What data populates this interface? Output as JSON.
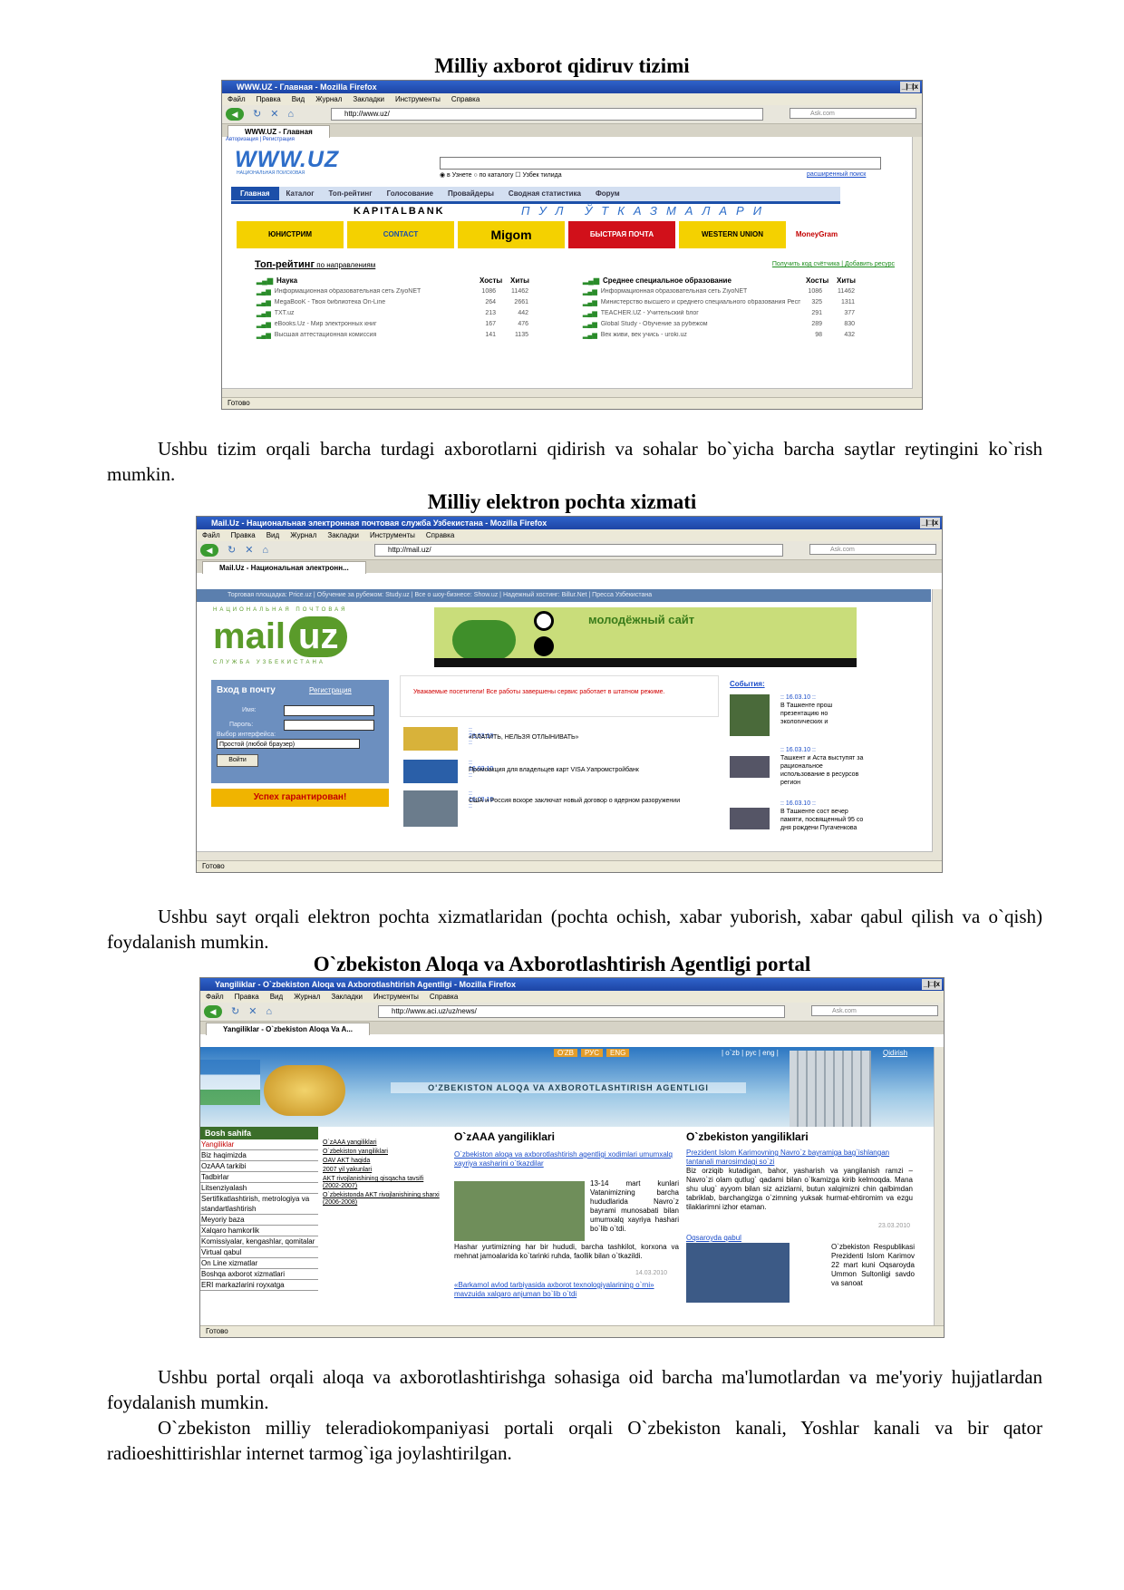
{
  "heading1": "Milliy axborot qidiruv tizimi",
  "heading2": "Milliy elektron pochta xizmati",
  "heading3": "O`zbekiston Aloqa va Axborotlashtirish Agentligi portal",
  "para1": "Ushbu tizim orqali barcha turdagi axborotlarni qidirish va sohalar bo`yicha barcha saytlar reytingini ko`rish mumkin.",
  "para2": "Ushbu sayt orqali elektron pochta xizmatlaridan (pochta ochish, xabar yuborish, xabar qabul qilish va o`qish) foydalanish mumkin.",
  "para3": "Ushbu portal orqali aloqa va axborotlashtirishga sohasiga oid barcha ma'lumotlardan va me'yoriy hujjatlardan foydalanish mumkin.",
  "para4": "O`zbekiston milliy teleradiokompaniyasi portali orqali O`zbekiston kanali, Yoshlar kanali va bir qator radioeshittirishlar internet tarmog`iga joylashtirilgan.",
  "browser": {
    "menu": [
      "Файл",
      "Правка",
      "Вид",
      "Журнал",
      "Закладки",
      "Инструменты",
      "Справка"
    ],
    "search_placeholder": "Ask.com",
    "status": "Готово",
    "controls": "_|□|x"
  },
  "shot1": {
    "title": "WWW.UZ - Главная - Mozilla Firefox",
    "url": "http://www.uz/",
    "tab": "WWW.UZ - Главная",
    "auth": "Авторизация | Регистрация",
    "logo": "WWW.UZ",
    "logo_sub": "НАЦИОНАЛЬНАЯ ПОИСКОВАЯ",
    "radio": "◉ в Узнете  ○ по каталогу   ☐ Узбек тилида",
    "advanced": "расширенный поиск",
    "tabs": [
      "Главная",
      "Каталог",
      "Топ-рейтинг",
      "Голосование",
      "Провайдеры",
      "Сводная статистика",
      "Форум"
    ],
    "bank": "KAPITALBANK",
    "bank_slogan": "ПУЛ ЎТКАЗМАЛАРИ",
    "ads": [
      "ЮНИСТРИМ",
      "CONTACT",
      "Migom",
      "БЫСТРАЯ ПОЧТА",
      "WESTERN UNION",
      "MoneyGram"
    ],
    "top_title": "Топ-рейтинг",
    "top_suffix": " по направлениям",
    "top_links": "Получить код счётчика | Добавить ресурс",
    "left_head": "Наука",
    "right_head": "Среднее специальное образование",
    "col_hosts": "Хосты",
    "col_hits": "Хиты",
    "left_rows": [
      {
        "name": "Информационная образовательная сеть ZiyoNET",
        "hosts": "1086",
        "hits": "11462"
      },
      {
        "name": "MegaBooK - Твоя библиотека On-Line",
        "hosts": "264",
        "hits": "2661"
      },
      {
        "name": "TXT.uz",
        "hosts": "213",
        "hits": "442"
      },
      {
        "name": "eBooks.Uz - Мир электронных книг",
        "hosts": "167",
        "hits": "476"
      },
      {
        "name": "Высшая аттестационная комиссия",
        "hosts": "141",
        "hits": "1135"
      }
    ],
    "right_rows": [
      {
        "name": "Информационная образовательная сеть ZiyoNET",
        "hosts": "1086",
        "hits": "11462"
      },
      {
        "name": "Министерство высшего и среднего специального образования Республики Узбекистан",
        "hosts": "325",
        "hits": "1311"
      },
      {
        "name": "TEACHER.UZ - Учительский блог",
        "hosts": "291",
        "hits": "377"
      },
      {
        "name": "Global Study - Обучение за рубежом",
        "hosts": "289",
        "hits": "830"
      },
      {
        "name": "Век живи, век учись - uroki.uz",
        "hosts": "98",
        "hits": "432"
      }
    ]
  },
  "shot2": {
    "title": "Mail.Uz - Национальная электронная почтовая служба Узбекистана - Mozilla Firefox",
    "url": "http://mail.uz/",
    "tab": "Mail.Uz - Национальная электронн...",
    "topbar": "Торговая площадка: Price.uz   |   Обучение за рубежом: Study.uz   |   Все о шоу-бизнесе: Show.uz   |   Надежный хостинг: Billur.Net   |   Пресса Узбекистана",
    "logo_top": "НАЦИОНАЛЬНАЯ ПОЧТОВАЯ",
    "logo_mail": "mail",
    "logo_uz": "uz",
    "logo_bottom": "СЛУЖБА УЗБЕКИСТАНА",
    "banner": "молодёжный сайт",
    "login_head": "Вход в почту",
    "register": "Регистрация",
    "name_label": "Имя:",
    "pass_label": "Пароль:",
    "iface_label": "Выбор интерфейса:",
    "iface_value": "Простой (любой браузер)",
    "login_btn": "Войти",
    "success": "Успех гарантирован!",
    "notice": "Уважаемые посетители! Все работы завершены сервис работает в штатном режиме.",
    "news": [
      {
        "date": ":: 23.03.10 ::",
        "text": "«ПЛАТИТЬ, НЕЛЬЗЯ ОТЛЫНИВАТЬ»"
      },
      {
        "date": ":: 16.03.10 ::",
        "text": "Промоакция для владельцев карт VISA Уапромстройбанк"
      },
      {
        "date": ":: 16.03.10 ::",
        "text": "США и Россия вскоре заключат новый договор о ядерном разоружении"
      }
    ],
    "events_head": "События:",
    "events": [
      {
        "date": ":: 16.03.10 ::",
        "text": "В Ташкенте прош презентацию но экологических и"
      },
      {
        "date": ":: 16.03.10 ::",
        "text": "Ташкент и Аста выступят за рациональное использование в ресурсов регион"
      },
      {
        "date": ":: 16.03.10 ::",
        "text": "В Ташкенте сост вечер памяти, посвященный 95 со дня рождени Пугаченкова"
      }
    ]
  },
  "shot3": {
    "title": "Yangiliklar - O`zbekiston Aloqa va Axborotlashtirish Agentligi - Mozilla Firefox",
    "url": "http://www.aci.uz/uz/news/",
    "tab": "Yangiliklar - O`zbekiston Aloqa Va A...",
    "feeds": [
      "O'ZB",
      "РУС",
      "ENG"
    ],
    "langs": "| o`zb | рус | eng |",
    "qidirish": "Qidirish",
    "site_title": "O'ZBEKISTON ALOQA VA AXBOROTLASHTIRISH AGENTLIGI",
    "side_head": "Bosh sahifa",
    "side_items": [
      "Yangiliklar",
      "Biz haqimizda",
      "OzAAA tarkibi",
      "Tadbirlar",
      "Litsenziyalash",
      "Sertifikatlashtirish, metrologiya va standartlashtirish",
      "Meyoriy baza",
      "Xalqaro hamkorlik",
      "Komissiyalar, kengashlar, qomitalar",
      "Virtual qabul",
      "On Line xizmatlar",
      "Boshqa axborot xizmatlari",
      "ERI markazlarini royxatga"
    ],
    "sub_items": [
      "O`zAAA yangiliklari",
      "O`zbekiston yangiliklari",
      "OAV AKT haqida",
      "2007 yil yakunlari",
      "AKT rivojlanishining qisqacha tavsifi (2002-2007)",
      "O`zbekistonda AKT rivojlanishining sharxi (2006-2008)"
    ],
    "col1_head": "O`zAAA yangiliklari",
    "col2_head": "O`zbekiston yangiliklari",
    "c1_link1": "O`zbekiston aloqa va axborotlashtirish agentligi xodimlari umumxalq xayriya xasharini o`tkazdilar",
    "c1_text1": "13-14 mart kunlari Vatanimizning barcha hududlarida Navro`z bayrami munosabati bilan umumxalq xayriya hashari bo`lib o`tdi.",
    "c1_text2": "Hashar yurtimizning har bir hududi, barcha tashkilot, korxona va mehnat jamoalarida ko`tarinki ruhda, faollik bilan o`tkazildi.",
    "c1_date": "14.03.2010",
    "c1_link2": "«Barkamol avlod tarbiyasida axborot texnologiyalarining o`rni» mavzuida xalqaro anjuman bo`lib o`tdi",
    "c2_link1": "Prezident Islom Karimovning Navro`z bayramiga bag`ishlangan tantanali marosimdagi so`zi",
    "c2_text1": "Biz orziqib kutadigan, bahor, yasharish va yangilanish ramzi – Navro`zi olam qutlug` qadami bilan o`lkamizga kirib kelmoqda. Mana shu ulug` ayyom bilan siz azizlarni, butun xalqimizni chin qalbimdan tabriklab, barchangizga o`zimning yuksak hurmat-ehtiromim va ezgu tilaklarimni izhor etaman.",
    "c2_date": "23.03.2010",
    "c2_link2": "Oqsaroyda qabul",
    "c2_text2": "O`zbekiston Respublikasi Prezidenti Islom Karimov 22 mart kuni Oqsaroyda Ummon Sultonligi savdo va sanoat"
  }
}
